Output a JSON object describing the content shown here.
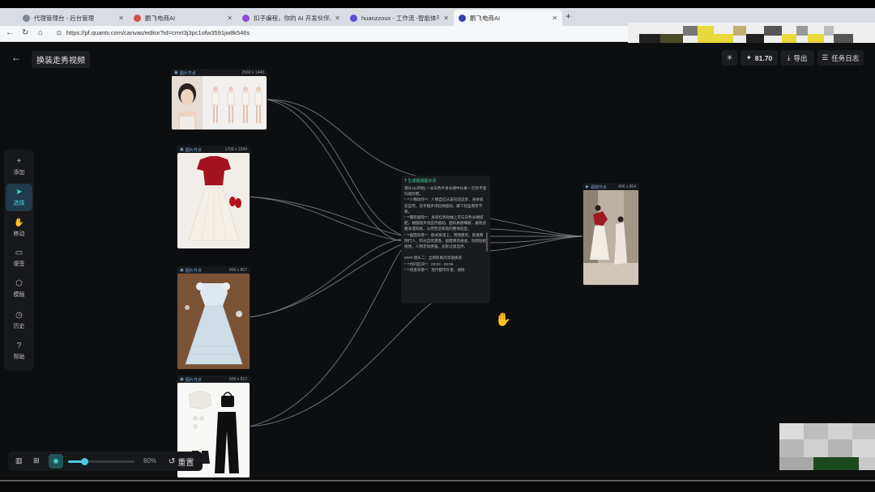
{
  "browser": {
    "tabs": [
      {
        "title": "代理管理台 - 后台管理",
        "color": "#7d8794",
        "active": false
      },
      {
        "title": "鹏飞电商AI",
        "color": "#d05050",
        "active": false
      },
      {
        "title": "扣子编程，你的 AI 开发伙伴。Vi…",
        "color": "#8a4fd6",
        "active": false
      },
      {
        "title": "huanzzoux - 工作流 -智能体平台",
        "color": "#5a4fd6",
        "active": false
      },
      {
        "title": "鹏飞电商AI",
        "color": "#3b3fa8",
        "active": true
      }
    ],
    "url": "https://pf.quantv.com/canvas/editor?id=cmrt3j3pc1ofw3591jw8k546s"
  },
  "project": {
    "title": "换装走秀视频"
  },
  "topbar": {
    "credits": "81.70",
    "export_label": "导出",
    "log_label": "任务日志"
  },
  "tools": [
    {
      "label": "添加",
      "icon": "plus-icon",
      "glyph": "+"
    },
    {
      "label": "选择",
      "icon": "cursor-icon",
      "glyph": "➤"
    },
    {
      "label": "移动",
      "icon": "hand-icon",
      "glyph": "✋"
    },
    {
      "label": "便签",
      "icon": "note-icon",
      "glyph": "▭"
    },
    {
      "label": "模版",
      "icon": "cube-icon",
      "glyph": "⬡"
    },
    {
      "label": "历史",
      "icon": "clock-icon",
      "glyph": "◷"
    },
    {
      "label": "帮助",
      "icon": "help-icon",
      "glyph": "?"
    }
  ],
  "nodes": [
    {
      "label": "图片节点",
      "size": "2560 x 1440"
    },
    {
      "label": "图片节点",
      "size": "1709 x 2344"
    },
    {
      "label": "图片节点",
      "size": "606 x 807"
    },
    {
      "label": "图片节点",
      "size": "606 x 812"
    },
    {
      "label": "视频节点",
      "size": "496 x 864"
    }
  ],
  "text_node": {
    "title": "生成视频提示词",
    "body": "镜头1(0开始) + 米白色半身长裙中长裙 + 红色平底玛丽珍鞋。\n* **人物动作**：人物自信从容向前迈步，身体姿态自然，双手随步伐轻微摆动，脚下轻盈而有节奏。\n* **服装展现**：身穿红色短袖上衣与白色长裙搭配，裙摆随步伐自然摆动，面料质感细腻，展现优雅浪漫风格，从而塑造和谐的整体造型。\n* **画面背景**：欧式街道上，周围建筑，街道两侧行人，阳光自然洒落，画面明亮通透，氛围轻松愉悦，人物走动感强，光影过渡自然。\n\n#### 镜头二：全新形象的华丽换装\n* **时间区间**：00:03 - 00:06\n* **场景背景**：现代都市外景，保持"
  },
  "zoom": {
    "value": "80%",
    "fraction": 0.25,
    "reset_label": "重置"
  }
}
